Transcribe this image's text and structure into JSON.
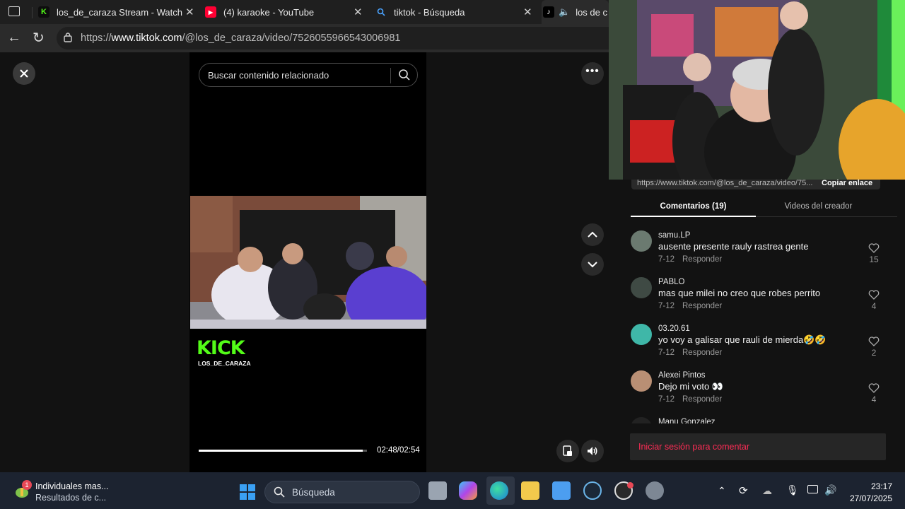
{
  "browser": {
    "tabs": [
      {
        "title": "los_de_caraza Stream - Watch Live",
        "icon": "kick-icon",
        "close": "✕"
      },
      {
        "title": "(4) karaoke - YouTube",
        "icon": "youtube-icon",
        "close": "✕"
      },
      {
        "title": "tiktok - Búsqueda",
        "icon": "search-icon",
        "close": "✕"
      },
      {
        "title": "los de c",
        "icon": "tiktok-icon"
      }
    ],
    "url_prefix": "https://",
    "url_host": "www.tiktok.com",
    "url_path": "/@los_de_caraza/video/7526055966543006981"
  },
  "viewer": {
    "search_placeholder": "Buscar contenido relacionado",
    "watermark": "KICK",
    "watermark_channel": "LOS_DE_CARAZA",
    "progress_fraction": 0.975,
    "time": "02:48/02:54"
  },
  "panel": {
    "link_text": "https://www.tiktok.com/@los_de_caraza/video/75...",
    "copy_link": "Copiar enlace",
    "tabs": [
      "Comentarios (19)",
      "Videos del creador"
    ],
    "comments": [
      {
        "user": "samu.LP",
        "text": "ausente presente rauly rastrea gente",
        "date": "7-12",
        "reply": "Responder",
        "likes": "15",
        "color": "#6b7a70"
      },
      {
        "user": "PABLO",
        "text": "mas que milei no creo que robes perrito",
        "date": "7-12",
        "reply": "Responder",
        "likes": "4",
        "color": "#3f4a44"
      },
      {
        "user": "03.20.61",
        "text": "yo voy a galisar que rauli de mierda🤣🤣",
        "date": "7-12",
        "reply": "Responder",
        "likes": "2",
        "color": "#3fb7a8"
      },
      {
        "user": "Alexei Pintos",
        "text": "Dejo mi voto 👀",
        "date": "7-12",
        "reply": "Responder",
        "likes": "4",
        "color": "#b98f74"
      }
    ],
    "partial_user": "Manu Gonzalez",
    "login": "Iniciar sesión para comentar"
  },
  "taskbar": {
    "notif_title": "Individuales mas...",
    "notif_sub": "Resultados de c...",
    "notif_badge": "1",
    "search": "Búsqueda",
    "time": "23:17",
    "date": "27/07/2025"
  },
  "colors": {
    "accent": "#fe2c55",
    "kick": "#53fc18"
  }
}
